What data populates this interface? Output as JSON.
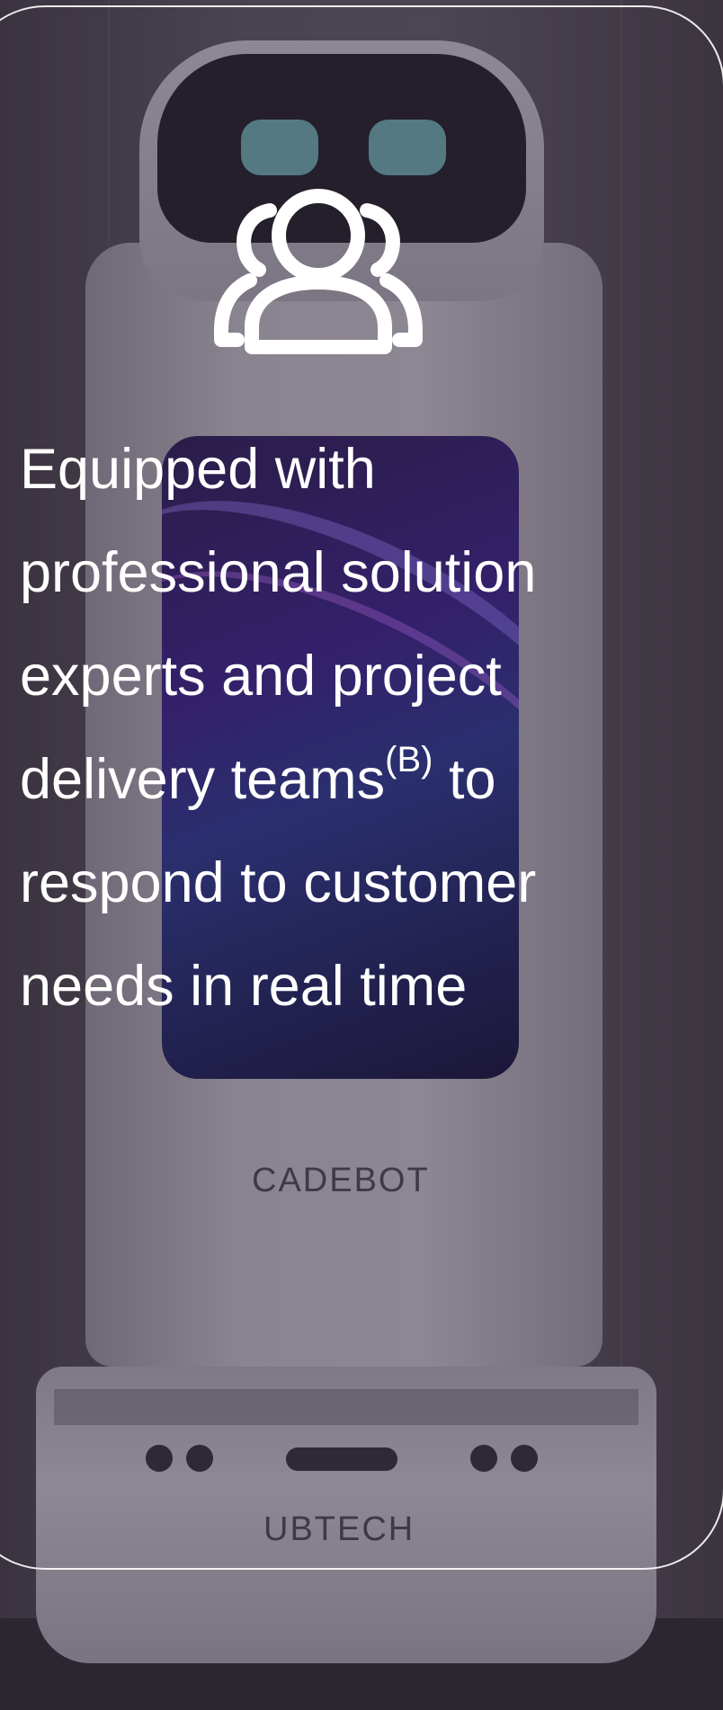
{
  "card": {
    "icon": "people-group-icon",
    "headline_before": "Equipped with professional solution experts and project delivery teams",
    "footnote_marker": "(B)",
    "headline_after": " to respond to customer needs in real time"
  },
  "background_photo": {
    "description_labels": {
      "screen_brand": "CADEBOT",
      "base_brand": "UBTECH"
    }
  },
  "colors": {
    "text": "#ffffff",
    "overlay": "#4a4350",
    "card_border": "#ffffff"
  }
}
